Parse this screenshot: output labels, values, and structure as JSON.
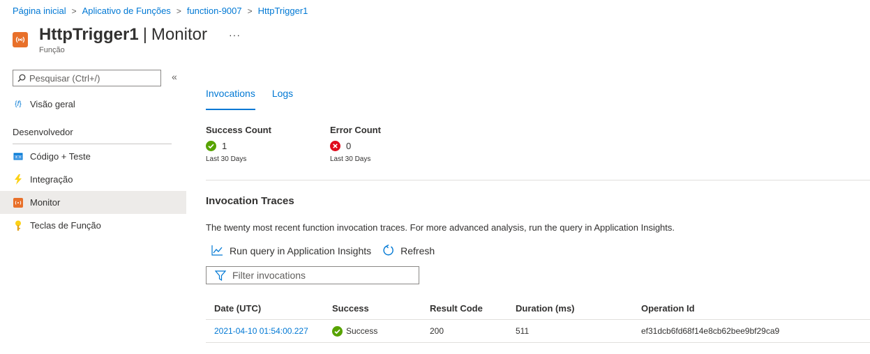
{
  "breadcrumb": [
    "Página inicial",
    "Aplicativo de Funções",
    "function-9007",
    "HttpTrigger1"
  ],
  "header": {
    "title_main": "HttpTrigger1",
    "title_divider": "|",
    "title_section": "Monitor",
    "subtitle": "Função",
    "more": "···"
  },
  "sidebar": {
    "search_placeholder": "Pesquisar (Ctrl+/)",
    "collapse": "«",
    "overview": "Visão geral",
    "section": "Desenvolvedor",
    "items": [
      {
        "label": "Código + Teste",
        "icon": "code-icon"
      },
      {
        "label": "Integração",
        "icon": "lightning-icon"
      },
      {
        "label": "Monitor",
        "icon": "monitor-icon",
        "active": true
      },
      {
        "label": "Teclas de Função",
        "icon": "key-icon"
      }
    ]
  },
  "tabs": [
    "Invocations",
    "Logs"
  ],
  "metrics": {
    "success": {
      "title": "Success Count",
      "value": "1",
      "sub": "Last 30 Days"
    },
    "error": {
      "title": "Error Count",
      "value": "0",
      "sub": "Last 30 Days"
    }
  },
  "traces": {
    "title": "Invocation Traces",
    "description": "The twenty most recent function invocation traces. For more advanced analysis, run the query in Application Insights.",
    "run_query": "Run query in Application Insights",
    "refresh": "Refresh",
    "filter_placeholder": "Filter invocations"
  },
  "table": {
    "headers": [
      "Date (UTC)",
      "Success",
      "Result Code",
      "Duration (ms)",
      "Operation Id"
    ],
    "rows": [
      [
        "2021-04-10 01:54:00.227",
        "Success",
        "200",
        "511",
        "ef31dcb6fd68f14e8cb62bee9bf29ca9"
      ]
    ]
  },
  "colors": {
    "accent": "#0078d4",
    "success": "#57a300",
    "error": "#e00b1c",
    "resource": "#e8702a"
  }
}
